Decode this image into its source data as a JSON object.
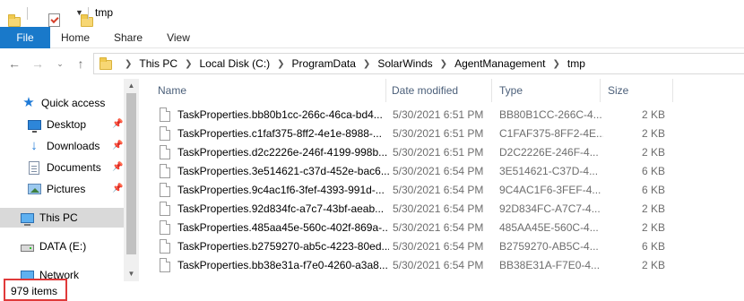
{
  "window": {
    "title": "tmp"
  },
  "ribbon": {
    "tabs": [
      {
        "label": "File",
        "active": true
      },
      {
        "label": "Home"
      },
      {
        "label": "Share"
      },
      {
        "label": "View"
      }
    ]
  },
  "address": {
    "crumbs": [
      "This PC",
      "Local Disk (C:)",
      "ProgramData",
      "SolarWinds",
      "AgentManagement",
      "tmp"
    ]
  },
  "nav_pane": {
    "items": [
      {
        "label": "Quick access",
        "icon": "star-icon"
      },
      {
        "label": "Desktop",
        "icon": "desktop-icon",
        "pinned": true
      },
      {
        "label": "Downloads",
        "icon": "download-arrow-icon",
        "pinned": true
      },
      {
        "label": "Documents",
        "icon": "documents-icon",
        "pinned": true
      },
      {
        "label": "Pictures",
        "icon": "pictures-icon",
        "pinned": true
      },
      {
        "label": "This PC",
        "icon": "computer-icon",
        "selected": true
      },
      {
        "label": "DATA (E:)",
        "icon": "drive-icon"
      },
      {
        "label": "Network",
        "icon": "network-icon"
      }
    ]
  },
  "file_list": {
    "columns": [
      "Name",
      "Date modified",
      "Type",
      "Size"
    ],
    "rows": [
      {
        "name": "TaskProperties.bb80b1cc-266c-46ca-bd4...",
        "date": "5/30/2021 6:51 PM",
        "type": "BB80B1CC-266C-4...",
        "size": "2 KB"
      },
      {
        "name": "TaskProperties.c1faf375-8ff2-4e1e-8988-...",
        "date": "5/30/2021 6:51 PM",
        "type": "C1FAF375-8FF2-4E...",
        "size": "2 KB"
      },
      {
        "name": "TaskProperties.d2c2226e-246f-4199-998b...",
        "date": "5/30/2021 6:51 PM",
        "type": "D2C2226E-246F-4...",
        "size": "2 KB"
      },
      {
        "name": "TaskProperties.3e514621-c37d-452e-bac6...",
        "date": "5/30/2021 6:54 PM",
        "type": "3E514621-C37D-4...",
        "size": "6 KB"
      },
      {
        "name": "TaskProperties.9c4ac1f6-3fef-4393-991d-...",
        "date": "5/30/2021 6:54 PM",
        "type": "9C4AC1F6-3FEF-4...",
        "size": "6 KB"
      },
      {
        "name": "TaskProperties.92d834fc-a7c7-43bf-aeab...",
        "date": "5/30/2021 6:54 PM",
        "type": "92D834FC-A7C7-4...",
        "size": "2 KB"
      },
      {
        "name": "TaskProperties.485aa45e-560c-402f-869a-...",
        "date": "5/30/2021 6:54 PM",
        "type": "485AA45E-560C-4...",
        "size": "2 KB"
      },
      {
        "name": "TaskProperties.b2759270-ab5c-4223-80ed...",
        "date": "5/30/2021 6:54 PM",
        "type": "B2759270-AB5C-4...",
        "size": "6 KB"
      },
      {
        "name": "TaskProperties.bb38e31a-f7e0-4260-a3a8...",
        "date": "5/30/2021 6:54 PM",
        "type": "BB38E31A-F7E0-4...",
        "size": "2 KB"
      }
    ]
  },
  "status": {
    "item_count": "979 items"
  },
  "colors": {
    "ribbon_file_tab": "#1979ca",
    "highlight_box": "#e03a3a",
    "nav_selected": "#d9d9d9"
  }
}
